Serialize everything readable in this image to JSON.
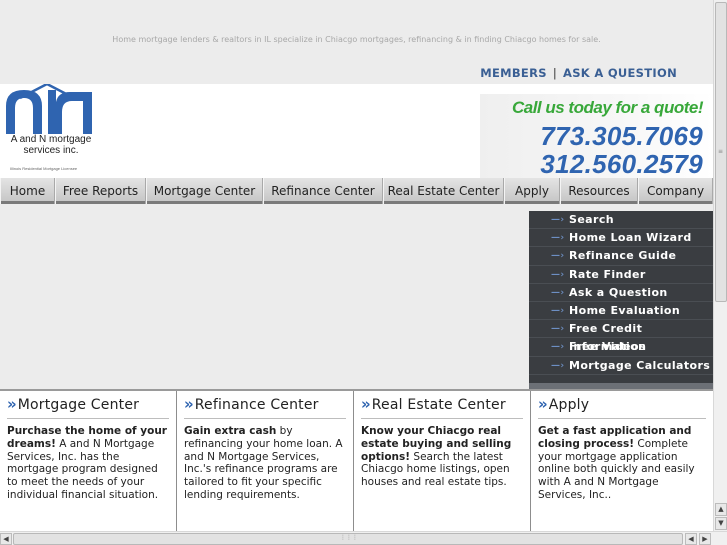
{
  "tagline": "Home mortgage lenders & realtors in IL specialize in Chiacgo mortgages, refinancing & in finding Chiacgo homes for sale.",
  "toplinks": {
    "members": "MEMBERS",
    "separator": "|",
    "ask": "ASK A QUESTION"
  },
  "logo": {
    "name_line1": "A and N mortgage",
    "name_line2": "services inc.",
    "sub": "Illinois Residential Mortgage Licensee"
  },
  "callbox": {
    "title": "Call us today for a quote!",
    "phone1": "773.305.7069",
    "phone2": "312.560.2579"
  },
  "nav": [
    {
      "label": "Home"
    },
    {
      "label": "Free Reports"
    },
    {
      "label": "Mortgage Center"
    },
    {
      "label": "Refinance Center"
    },
    {
      "label": "Real Estate Center"
    },
    {
      "label": "Apply"
    },
    {
      "label": "Resources"
    },
    {
      "label": "Company"
    }
  ],
  "sidemenu": [
    {
      "label": "Search"
    },
    {
      "label": "Home Loan Wizard"
    },
    {
      "label": "Refinance Guide"
    },
    {
      "label": "Rate Finder"
    },
    {
      "label": "Ask a Question"
    },
    {
      "label": "Home Evaluation"
    },
    {
      "label": "Free Credit Information"
    },
    {
      "label": "Free Videos"
    },
    {
      "label": "Mortgage Calculators"
    }
  ],
  "boxes": [
    {
      "title": "Mortgage Center",
      "lead": "Purchase the home of your dreams!",
      "text": " A and N Mortgage Services, Inc. has the mortgage program designed to meet the needs of your individual financial situation."
    },
    {
      "title": "Refinance Center",
      "lead": "Gain extra cash",
      "text": " by refinancing your home loan. A and N Mortgage Services, Inc.'s refinance programs are tailored to fit your specific lending requirements."
    },
    {
      "title": "Real Estate Center",
      "lead": "Know your Chiacgo real estate buying and selling options!",
      "text": " Search the latest Chiacgo home listings, open houses and real estate tips."
    },
    {
      "title": "Apply",
      "lead": "Get a fast application and closing process!",
      "text": " Complete your mortgage application online both quickly and easily with A and N Mortgage Services, Inc.."
    }
  ],
  "colors": {
    "accent_blue": "#2f64b0",
    "call_green": "#38a83a",
    "menu_bg": "#3a3d41"
  }
}
